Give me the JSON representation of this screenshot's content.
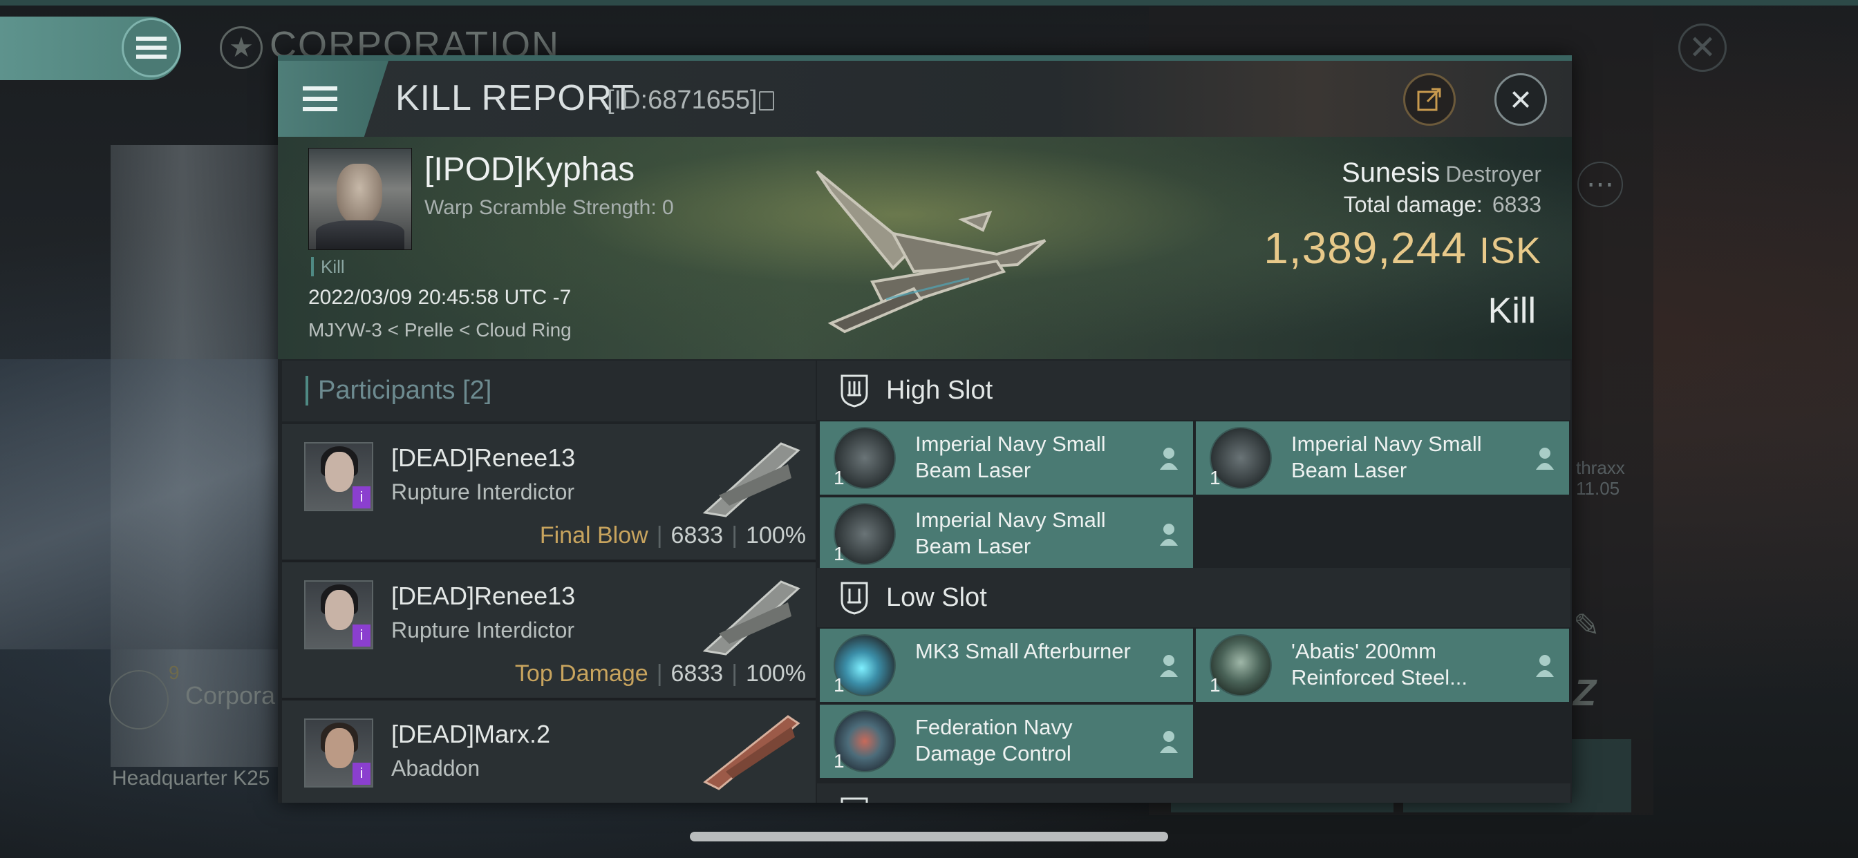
{
  "background": {
    "corp_title": "CORPORATION",
    "corpora_label": "Corpora",
    "corpora_count": "9",
    "hq_label": "Headquarter K25",
    "thraxx_line1": "thraxx",
    "thraxx_line2": "11.05"
  },
  "header": {
    "title": "KILL REPORT",
    "id": "[ID:6871655]"
  },
  "victim": {
    "name": "[IPOD]Kyphas",
    "warp_scramble": "Warp Scramble Strength: 0",
    "kill_tag": "Kill",
    "datetime": "2022/03/09 20:45:58 UTC -7",
    "location": "MJYW-3 < Prelle < Cloud Ring",
    "ship": "Sunesis",
    "ship_class": "Destroyer",
    "total_damage_label": "Total damage:",
    "total_damage": "6833",
    "isk_value": "1,389,244",
    "isk_unit": "ISK",
    "result": "Kill"
  },
  "participants": {
    "title": "Participants",
    "count": "[2]",
    "items": [
      {
        "name": "[DEAD]Renee13",
        "ship": "Rupture Interdictor",
        "label": "Final Blow",
        "damage": "6833",
        "percent": "100%"
      },
      {
        "name": "[DEAD]Renee13",
        "ship": "Rupture Interdictor",
        "label": "Top Damage",
        "damage": "6833",
        "percent": "100%"
      },
      {
        "name": "[DEAD]Marx.2",
        "ship": "Abaddon"
      }
    ]
  },
  "fittings": {
    "high_slot": {
      "title": "High Slot",
      "items": [
        {
          "qty": "1",
          "name": "Imperial Navy Small Beam Laser"
        },
        {
          "qty": "1",
          "name": "Imperial Navy Small Beam Laser"
        },
        {
          "qty": "1",
          "name": "Imperial Navy Small Beam Laser"
        }
      ]
    },
    "low_slot": {
      "title": "Low Slot",
      "items": [
        {
          "qty": "1",
          "name": "MK3 Small Afterburner"
        },
        {
          "qty": "1",
          "name": "'Abatis' 200mm Reinforced Steel..."
        },
        {
          "qty": "1",
          "name": "Federation Navy Damage Control"
        }
      ]
    }
  },
  "colors": {
    "accent": "#4a7a73",
    "isk": "#e8c98a",
    "label_gold": "#c8a45e",
    "badge_purple": "#8b3fcf"
  }
}
